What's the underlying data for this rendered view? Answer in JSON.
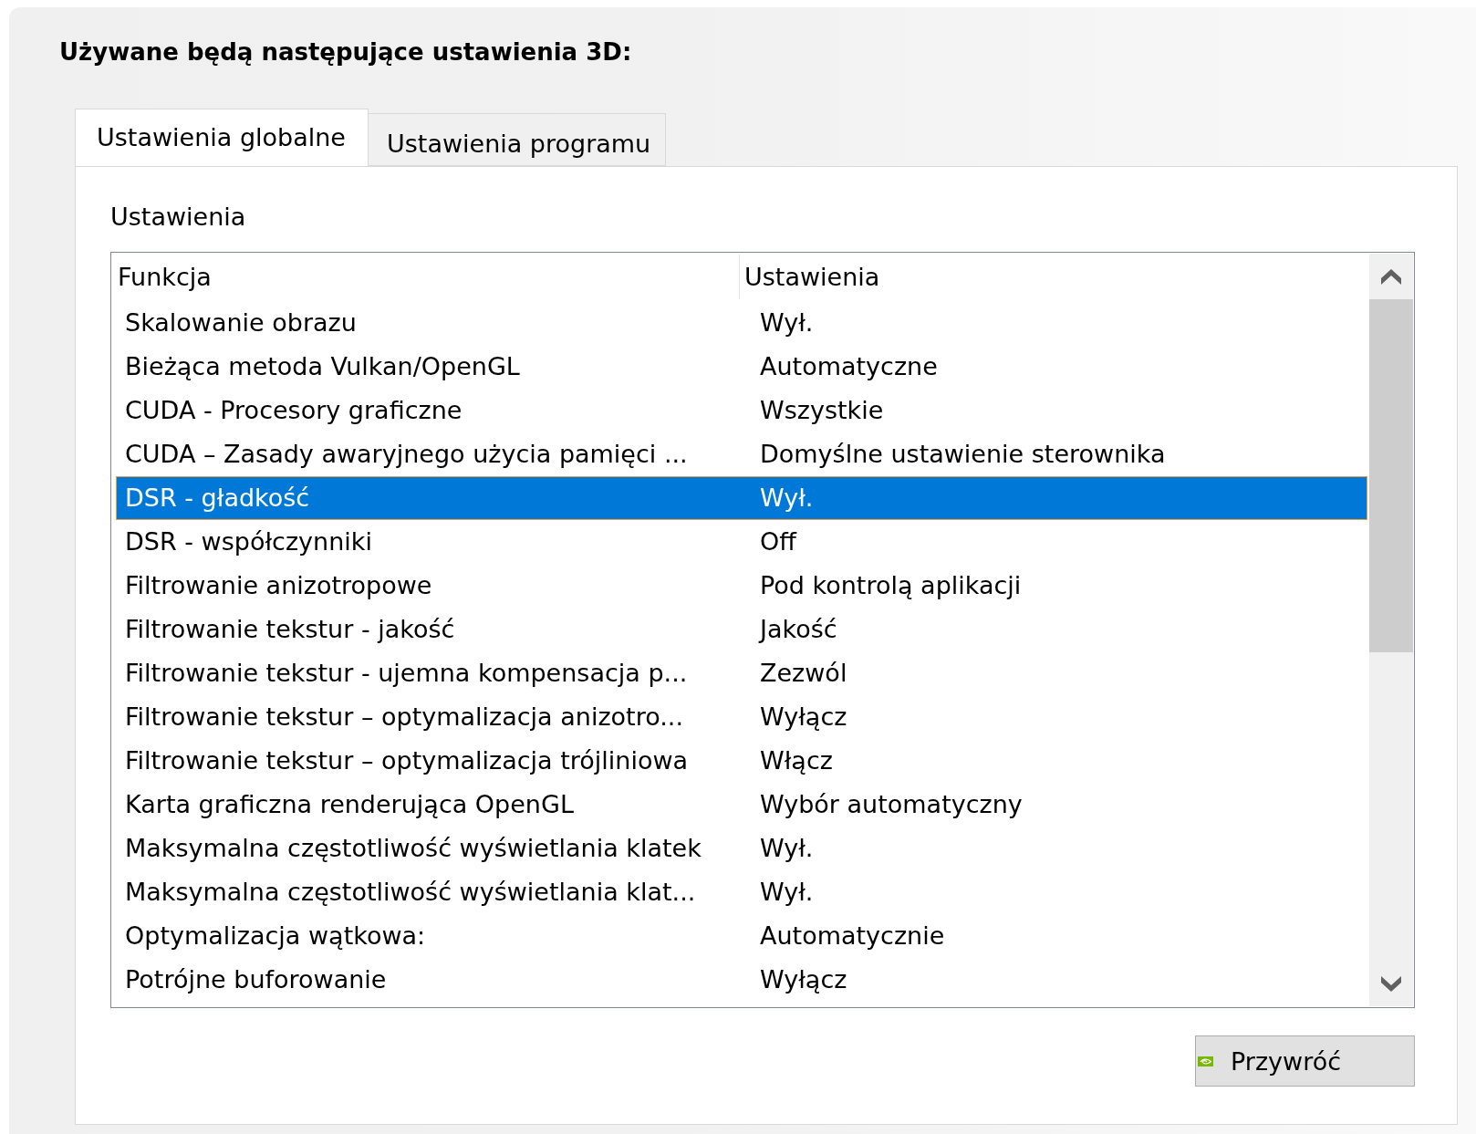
{
  "heading": "Używane będą następujące ustawienia 3D:",
  "tabs": [
    {
      "label": "Ustawienia globalne",
      "selected": true
    },
    {
      "label": "Ustawienia programu",
      "selected": false
    }
  ],
  "settings": {
    "label": "Ustawienia",
    "columns": [
      "Funkcja",
      "Ustawienia"
    ],
    "rows": [
      {
        "feature": "Skalowanie obrazu",
        "value": "Wył.",
        "selected": false
      },
      {
        "feature": "Bieżąca metoda Vulkan/OpenGL",
        "value": "Automatyczne",
        "selected": false
      },
      {
        "feature": "CUDA - Procesory graficzne",
        "value": "Wszystkie",
        "selected": false
      },
      {
        "feature": "CUDA – Zasady awaryjnego użycia pamięci ...",
        "value": "Domyślne ustawienie sterownika",
        "selected": false
      },
      {
        "feature": "DSR - gładkość",
        "value": "Wył.",
        "selected": true
      },
      {
        "feature": "DSR - współczynniki",
        "value": "Off",
        "selected": false
      },
      {
        "feature": "Filtrowanie anizotropowe",
        "value": "Pod kontrolą aplikacji",
        "selected": false
      },
      {
        "feature": "Filtrowanie tekstur - jakość",
        "value": "Jakość",
        "selected": false
      },
      {
        "feature": "Filtrowanie tekstur - ujemna kompensacja p...",
        "value": "Zezwól",
        "selected": false
      },
      {
        "feature": "Filtrowanie tekstur – optymalizacja anizotro...",
        "value": "Wyłącz",
        "selected": false
      },
      {
        "feature": "Filtrowanie tekstur – optymalizacja trójliniowa",
        "value": "Włącz",
        "selected": false
      },
      {
        "feature": "Karta graficzna renderująca OpenGL",
        "value": "Wybór automatyczny",
        "selected": false
      },
      {
        "feature": "Maksymalna częstotliwość wyświetlania klatek",
        "value": "Wył.",
        "selected": false
      },
      {
        "feature": "Maksymalna częstotliwość wyświetlania klat...",
        "value": "Wył.",
        "selected": false
      },
      {
        "feature": "Optymalizacja wątkowa:",
        "value": "Automatycznie",
        "selected": false
      },
      {
        "feature": "Potrójne buforowanie",
        "value": "Wyłącz",
        "selected": false
      }
    ]
  },
  "buttons": [
    {
      "label": "Przywróć"
    }
  ]
}
